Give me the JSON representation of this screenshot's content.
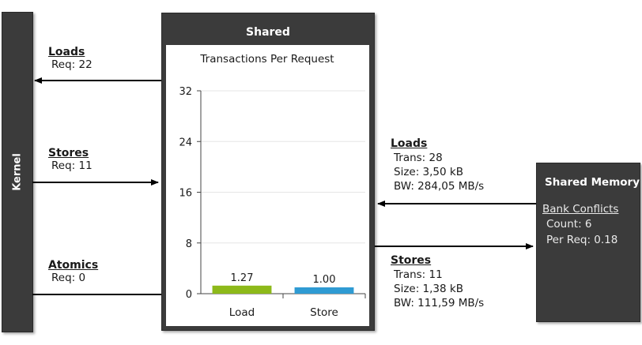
{
  "kernel": {
    "label": "Kernel"
  },
  "shared": {
    "title": "Shared"
  },
  "left_links": {
    "loads": {
      "title": "Loads",
      "req": "Req: 22"
    },
    "stores": {
      "title": "Stores",
      "req": "Req: 11"
    },
    "atomics": {
      "title": "Atomics",
      "req": "Req: 0"
    }
  },
  "right_links": {
    "loads": {
      "title": "Loads",
      "trans": "Trans: 28",
      "size": "Size: 3,50 kB",
      "bw": "BW: 284,05 MB/s"
    },
    "stores": {
      "title": "Stores",
      "trans": "Trans: 11",
      "size": "Size: 1,38 kB",
      "bw": "BW: 111,59 MB/s"
    }
  },
  "shared_memory": {
    "title": "Shared Memory",
    "bank_conflicts_link": "Bank Conflicts",
    "count": "Count: 6",
    "per_req": "Per Req: 0.18"
  },
  "chart_data": {
    "type": "bar",
    "title": "Transactions Per Request",
    "categories": [
      "Load",
      "Store"
    ],
    "values": [
      1.27,
      1.0
    ],
    "value_labels": [
      "1.27",
      "1.00"
    ],
    "colors": [
      "#8db91a",
      "#2f9bd3"
    ],
    "ylim": [
      0,
      32
    ],
    "yticks": [
      "0",
      "8",
      "16",
      "24",
      "32"
    ],
    "grid": true,
    "xlabel": "",
    "ylabel": ""
  }
}
